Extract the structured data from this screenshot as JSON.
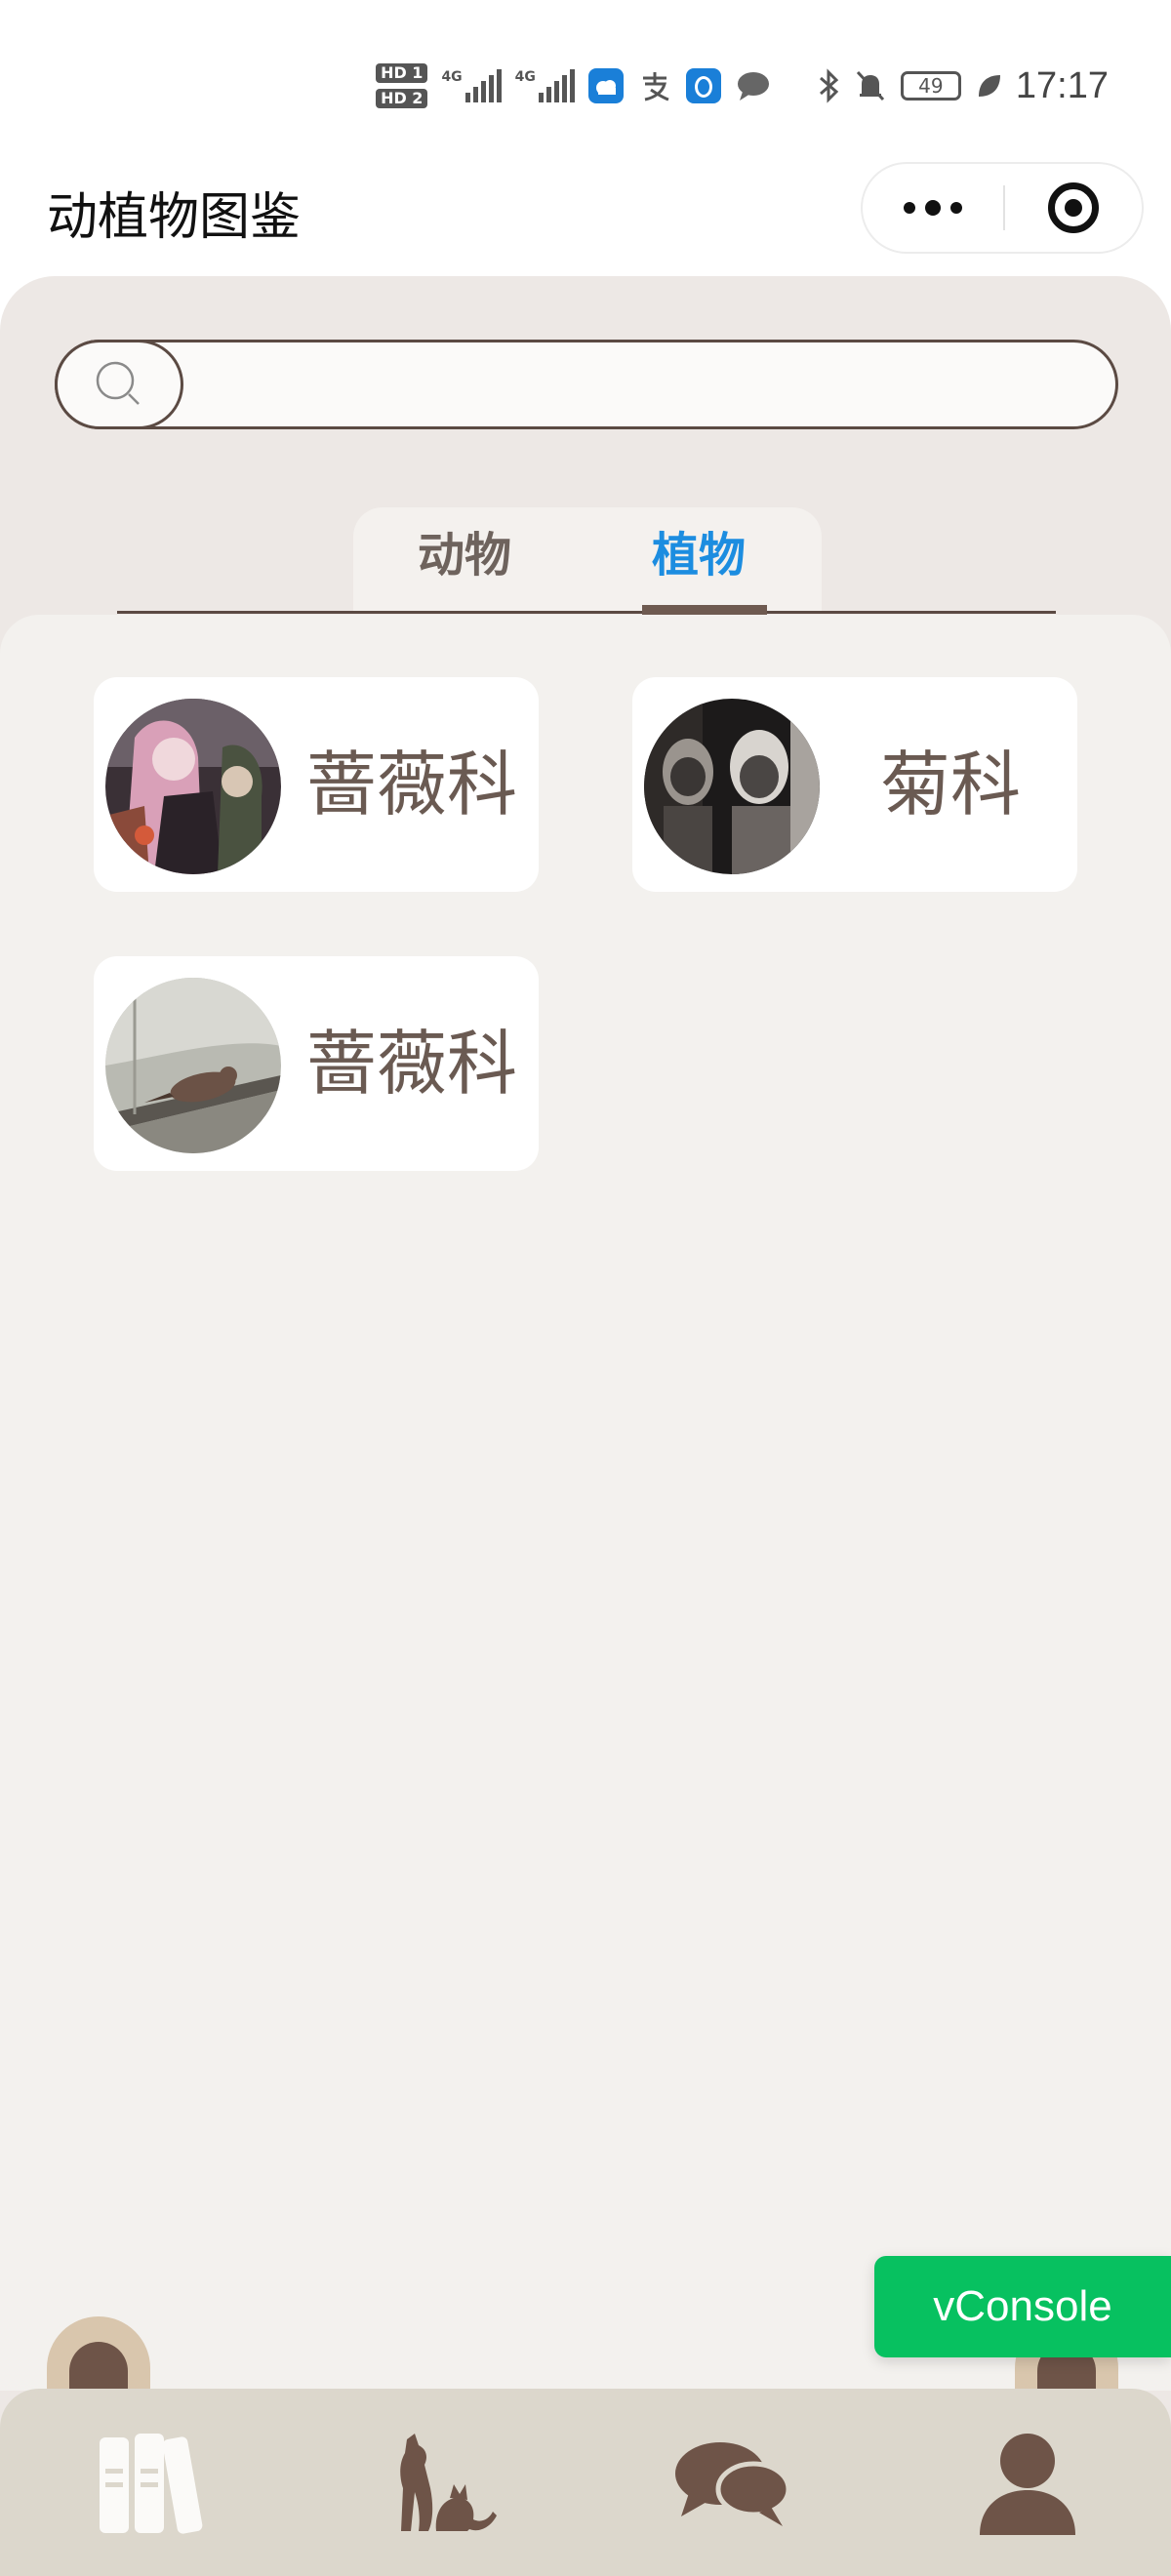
{
  "status_bar": {
    "sim1": "HD 1",
    "sim2": "HD 2",
    "network1": "4G",
    "network2": "4G",
    "battery": "49",
    "time": "17:17"
  },
  "header": {
    "title": "动植物图鉴"
  },
  "search": {
    "value": "",
    "placeholder": ""
  },
  "tabs": [
    {
      "label": "动物",
      "active": false
    },
    {
      "label": "植物",
      "active": true
    }
  ],
  "colors": {
    "accent": "#1c8de0",
    "brand_brown": "#5b4a43",
    "card_text": "#6a5a52",
    "vconsole_green": "#07c160",
    "tabbar_bg": "#dcd7cc"
  },
  "items": [
    {
      "name": "蔷薇科",
      "image": "anime-characters-group"
    },
    {
      "name": "菊科",
      "image": "masked-figures-monochrome"
    },
    {
      "name": "蔷薇科",
      "image": "bird-on-railing"
    }
  ],
  "vconsole": {
    "label": "vConsole"
  },
  "bottom_nav": [
    {
      "icon": "book-icon"
    },
    {
      "icon": "animal-icon"
    },
    {
      "icon": "chat-icon"
    },
    {
      "icon": "user-icon"
    }
  ]
}
